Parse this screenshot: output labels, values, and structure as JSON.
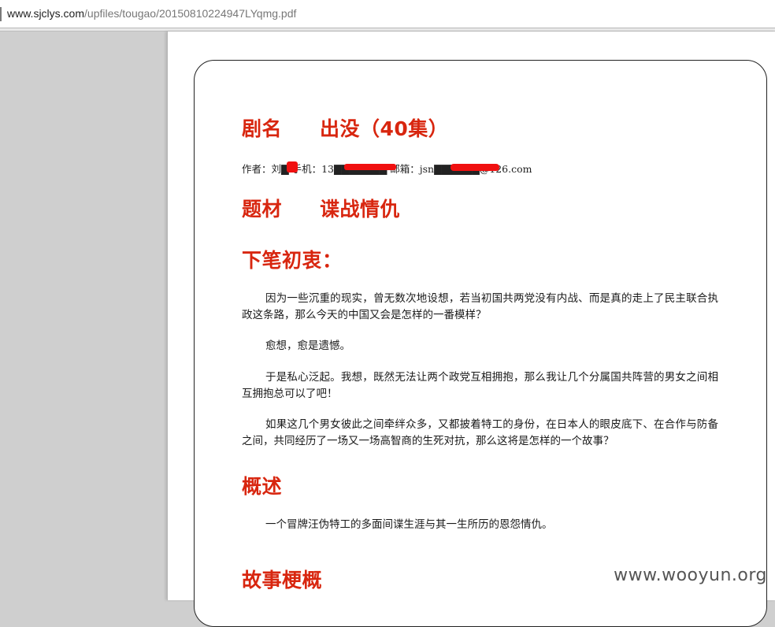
{
  "address_bar": {
    "url_host": "www.sjclys.com",
    "url_path": "/upfiles/tougao/20150810224947LYqmg.pdf"
  },
  "document": {
    "title_label": "剧名",
    "title_value": "出没（40集）",
    "author_line": "作者：刘▇ 手机：13▇▇▇▇▇▇▇ 邮箱：jsn▇▇▇▇▇▇@126.com",
    "subject_label": "题材",
    "subject_value": "谍战情仇",
    "motive_heading": "下笔初衷：",
    "motive_paragraphs": [
      "因为一些沉重的现实，曾无数次地设想，若当初国共两党没有内战、而是真的走上了民主联合执政这条路，那么今天的中国又会是怎样的一番模样？",
      "愈想，愈是遗憾。",
      "于是私心泛起。我想，既然无法让两个政党互相拥抱，那么我让几个分属国共阵营的男女之间相互拥抱总可以了吧！",
      "如果这几个男女彼此之间牵绊众多，又都披着特工的身份，在日本人的眼皮底下、在合作与防备之间，共同经历了一场又一场高智商的生死对抗，那么这将是怎样的一个故事？"
    ],
    "summary_heading": "概述",
    "summary_text": "一个冒牌汪伪特工的多面间谍生涯与其一生所历的恩怨情仇。",
    "synopsis_heading": "故事梗概"
  },
  "watermark": "www.wooyun.org",
  "colors": {
    "heading_red": "#d8260f",
    "redaction_red": "#f01010"
  }
}
